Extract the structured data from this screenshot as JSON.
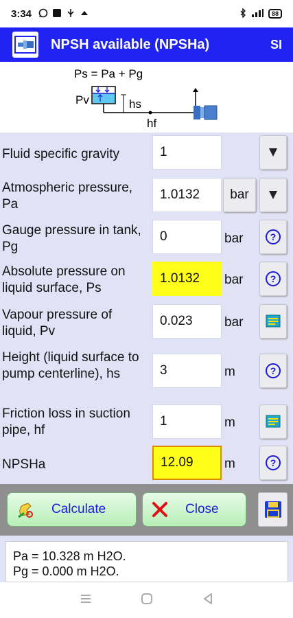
{
  "status_bar": {
    "time": "3:34",
    "left_icons": [
      "whatsapp-icon",
      "sd-icon",
      "usb-icon",
      "cloud-icon"
    ],
    "right_icons": [
      "bluetooth-icon",
      "signal-icon",
      "battery-icon"
    ],
    "battery": "88"
  },
  "header": {
    "title": "NPSH available (NPSHa)",
    "units": "SI"
  },
  "diagram": {
    "formula": "Ps = Pa + Pg",
    "pv": "Pv",
    "hs": "hs",
    "hf": "hf"
  },
  "form": {
    "rows": [
      {
        "label": "Fluid specific gravity",
        "value": "1",
        "unit": "",
        "button": "dropdown"
      },
      {
        "label": "Atmospheric pressure, Pa",
        "value": "1.0132",
        "unit": "bar",
        "button": "dropdown"
      },
      {
        "label": "Gauge pressure in tank, Pg",
        "value": "0",
        "unit": "bar",
        "button": "help"
      },
      {
        "label": "Absolute pressure on liquid surface, Ps",
        "value": "1.0132",
        "unit": "bar",
        "button": "help"
      },
      {
        "label": "Vapour pressure of liquid, Pv",
        "value": "0.023",
        "unit": "bar",
        "button": "table"
      },
      {
        "label": "Height (liquid surface to pump centerline), hs",
        "value": "3",
        "unit": "m",
        "button": "help"
      },
      {
        "label": "Friction loss in suction pipe, hf",
        "value": "1",
        "unit": "m",
        "button": "table"
      },
      {
        "label": "NPSHa",
        "value": "12.09",
        "unit": "m",
        "button": "help"
      }
    ]
  },
  "actions": {
    "calculate": "Calculate",
    "close": "Close"
  },
  "results": {
    "line1": "Pa = 10.328 m H2O.",
    "line2": "Pg = 0.000 m H2O."
  },
  "colors": {
    "title_bar": "#1f22f0",
    "form_bg": "#e2e2f6",
    "highlight": "#ffff1a",
    "accent_text": "#1a1ad8"
  }
}
